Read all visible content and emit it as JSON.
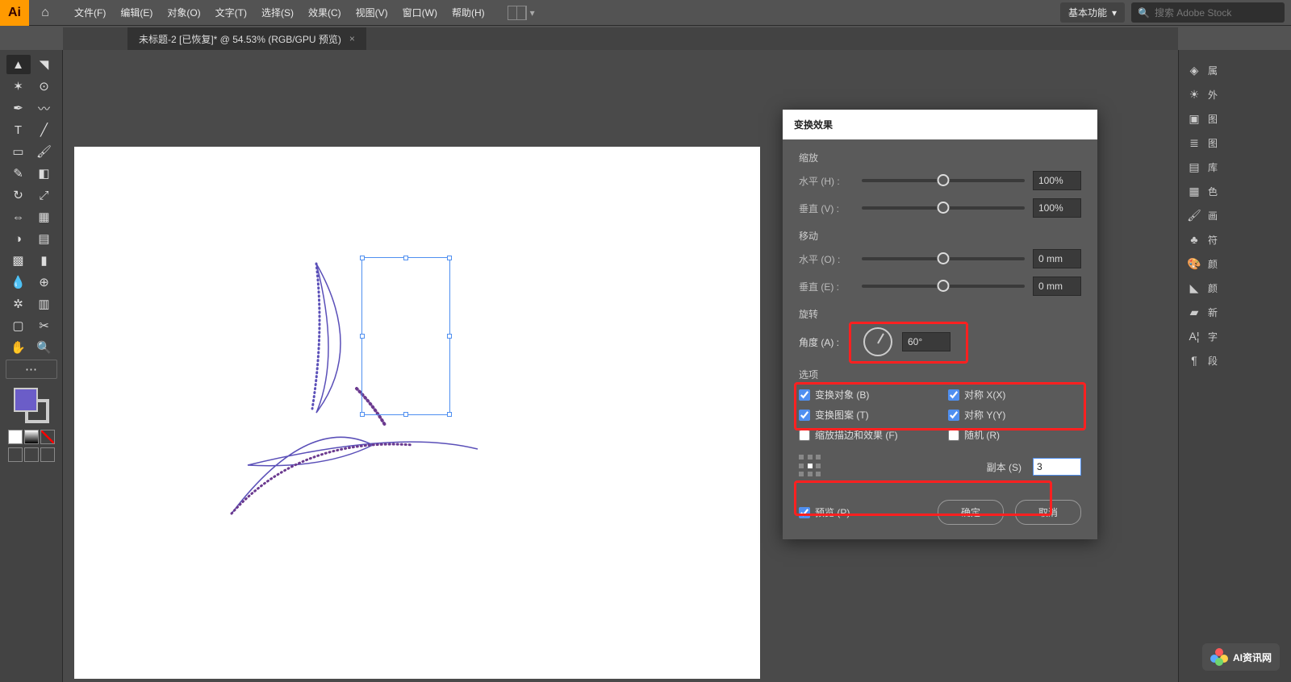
{
  "menubar": {
    "items": [
      "文件(F)",
      "编辑(E)",
      "对象(O)",
      "文字(T)",
      "选择(S)",
      "效果(C)",
      "视图(V)",
      "窗口(W)",
      "帮助(H)"
    ],
    "workspace": "基本功能",
    "search_placeholder": "搜索 Adobe Stock"
  },
  "tab": {
    "title": "未标题-2 [已恢复]* @ 54.53% (RGB/GPU 预览)"
  },
  "right_panels": [
    "属",
    "外",
    "图",
    "图",
    "库",
    "色",
    "画",
    "符",
    "颜",
    "颜",
    "新",
    "字",
    "段"
  ],
  "dialog": {
    "title": "变换效果",
    "scale": {
      "title": "缩放",
      "h_label": "水平 (H) :",
      "h_val": "100%",
      "v_label": "垂直 (V) :",
      "v_val": "100%"
    },
    "move": {
      "title": "移动",
      "h_label": "水平 (O) :",
      "h_val": "0 mm",
      "v_label": "垂直 (E) :",
      "v_val": "0 mm"
    },
    "rotate": {
      "title": "旋转",
      "angle_label": "角度 (A) :",
      "angle_val": "60°"
    },
    "options": {
      "title": "选项",
      "transform_obj": "变换对象 (B)",
      "reflect_x": "对称 X(X)",
      "transform_pat": "变换图案 (T)",
      "reflect_y": "对称 Y(Y)",
      "scale_strokes": "缩放描边和效果 (F)",
      "random": "随机 (R)"
    },
    "copies_label": "副本 (S)",
    "copies_val": "3",
    "preview": "预览 (P)",
    "ok": "确定",
    "cancel": "取消"
  },
  "watermark": "AI资讯网"
}
